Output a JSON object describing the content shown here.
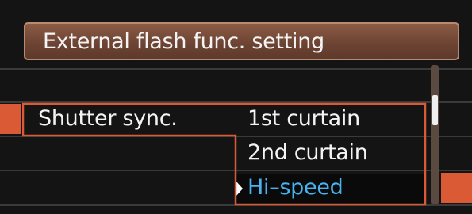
{
  "screen": {
    "title": "External flash func. setting"
  },
  "setting": {
    "label": "Shutter sync.",
    "options": [
      {
        "label": "1st curtain",
        "selected": false
      },
      {
        "label": "2nd curtain",
        "selected": false
      },
      {
        "label": "Hi–speed",
        "selected": true
      }
    ]
  },
  "colors": {
    "accent": "#d95a34",
    "title_bar": "#6e4433",
    "selected_text": "#47b3f0",
    "background": "#141414"
  },
  "icons": {
    "pointer": "triangle-right-icon",
    "scrollbar": "scrollbar"
  }
}
